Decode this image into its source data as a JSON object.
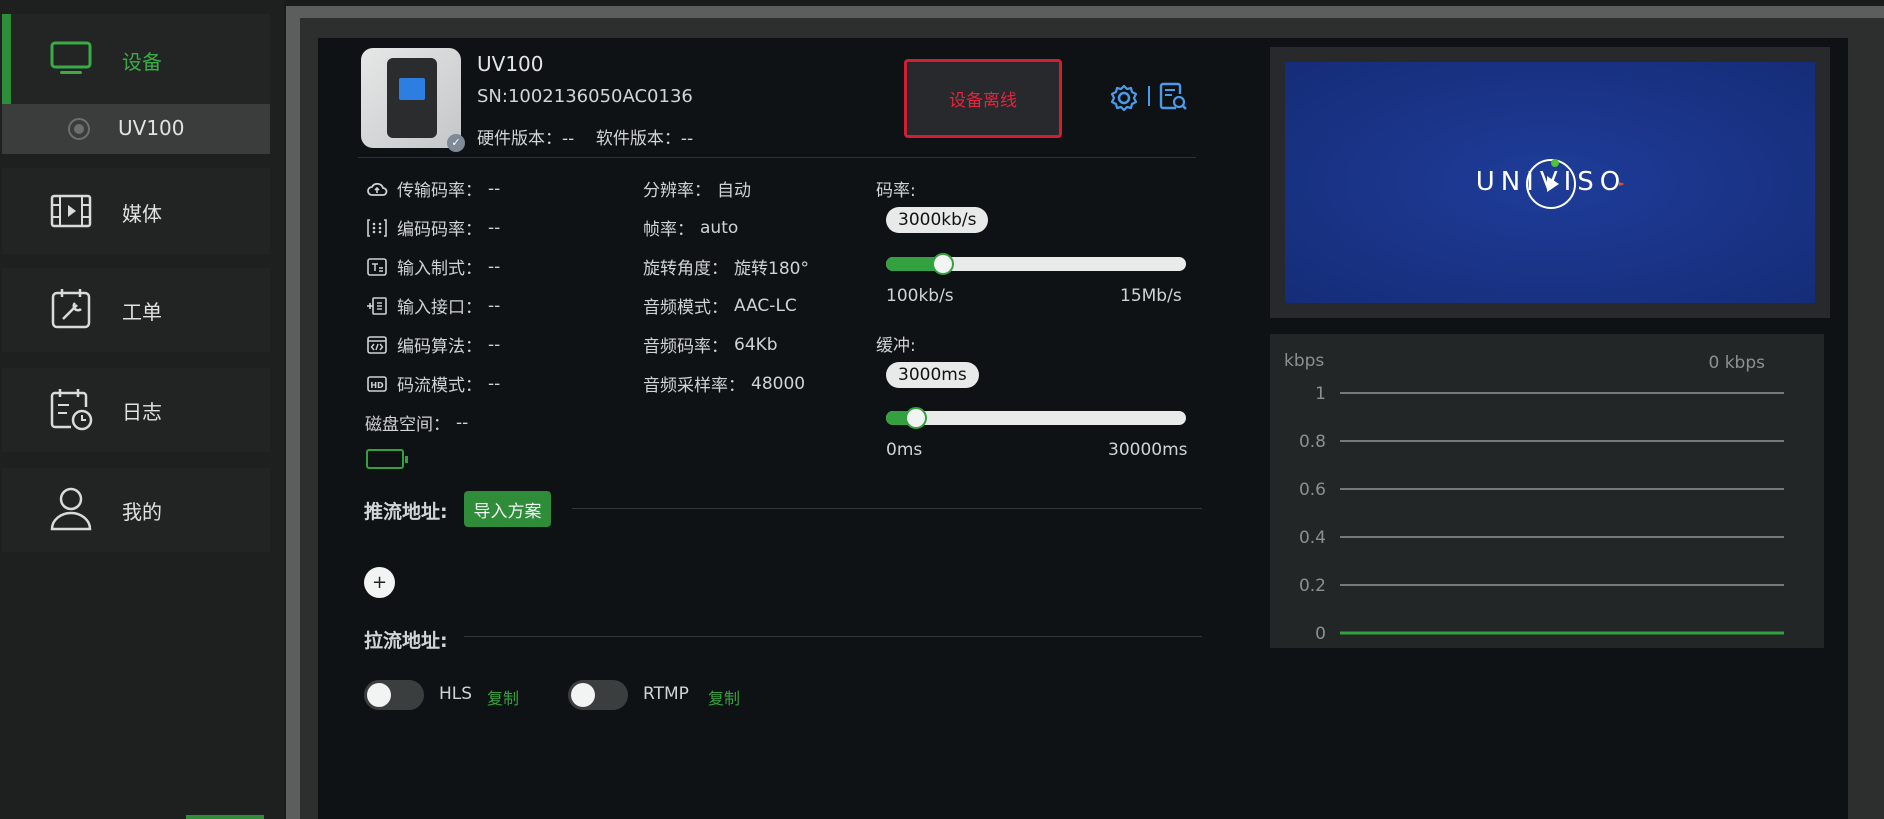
{
  "sidebar": {
    "items": [
      {
        "label": "设备",
        "icon": "monitor-icon"
      },
      {
        "label": "媒体",
        "icon": "film-icon"
      },
      {
        "label": "工单",
        "icon": "clipboard-tools-icon"
      },
      {
        "label": "日志",
        "icon": "calendar-clock-icon"
      },
      {
        "label": "我的",
        "icon": "user-icon"
      }
    ],
    "device_sub": {
      "label": "UV100"
    },
    "accent": "#2f8c38"
  },
  "device": {
    "name": "UV100",
    "sn": "SN:1002136050AC0136",
    "versions": "硬件版本：--    软件版本：--",
    "offline_label": "设备离线",
    "offline_color": "#d21d33"
  },
  "info_left": [
    {
      "label": "传输码率：",
      "value": "--",
      "icon": "cloud-upload-icon"
    },
    {
      "label": "编码码率：",
      "value": "--",
      "icon": "grid-dots-icon"
    },
    {
      "label": "输入制式：",
      "value": "--",
      "icon": "input-format-icon"
    },
    {
      "label": "输入接口：",
      "value": "--",
      "icon": "port-icon"
    },
    {
      "label": "编码算法：",
      "value": "--",
      "icon": "code-icon"
    },
    {
      "label": "码流模式：",
      "value": "--",
      "icon": "hd-icon"
    },
    {
      "label": "磁盘空间：",
      "value": "--"
    }
  ],
  "info_mid": [
    {
      "label": "分辨率：",
      "value": "自动"
    },
    {
      "label": "帧率：",
      "value": "auto"
    },
    {
      "label": "旋转角度：",
      "value": "旋转180°"
    },
    {
      "label": "音频模式：",
      "value": "AAC-LC"
    },
    {
      "label": "音频码率：",
      "value": "64Kb"
    },
    {
      "label": "音频采样率：",
      "value": "48000"
    }
  ],
  "bitrate": {
    "label": "码率:",
    "value_label": "3000kb/s",
    "min_label": "100kb/s",
    "max_label": "15Mb/s",
    "fraction": 0.19
  },
  "buffer": {
    "label": "缓冲:",
    "value_label": "3000ms",
    "min_label": "0ms",
    "max_label": "30000ms",
    "fraction": 0.1
  },
  "push": {
    "title": "推流地址:",
    "import_label": "导入方案",
    "add_label": "+"
  },
  "pull": {
    "title": "拉流地址:",
    "protocols": [
      {
        "label": "HLS",
        "copy": "复制",
        "enabled": false
      },
      {
        "label": "RTMP",
        "copy": "复制",
        "enabled": false
      }
    ]
  },
  "preview": {
    "logo_text": "UNIVISO"
  },
  "chart_data": {
    "type": "line",
    "ylabel": "kbps",
    "current": "0 kbps",
    "yticks": [
      "1",
      "0.8",
      "0.6",
      "0.4",
      "0.2",
      "0"
    ],
    "ylim": [
      0,
      1
    ],
    "series": [
      {
        "values": [
          0,
          0,
          0,
          0,
          0,
          0,
          0,
          0,
          0,
          0
        ],
        "color": "#33a13f"
      }
    ],
    "grid": true
  }
}
